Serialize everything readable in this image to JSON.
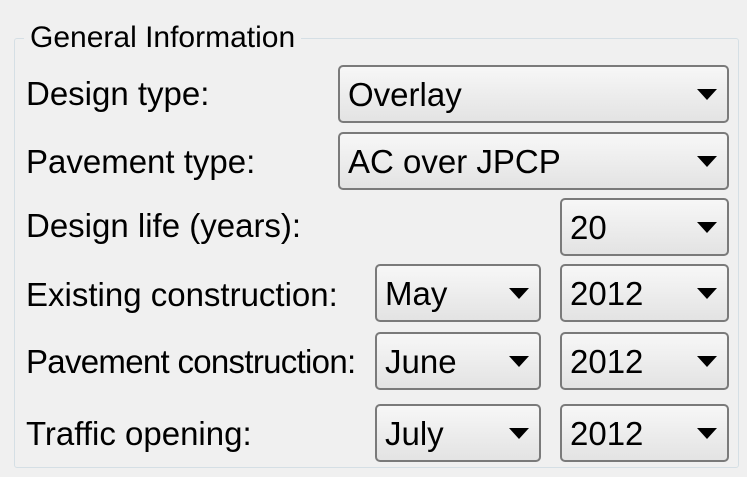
{
  "group": {
    "title": "General Information"
  },
  "rows": {
    "design_type": {
      "label": "Design type:",
      "value": "Overlay"
    },
    "pavement_type": {
      "label": "Pavement type:",
      "value": "AC over JPCP"
    },
    "design_life": {
      "label": "Design life (years):",
      "value": "20"
    },
    "existing_construction": {
      "label": "Existing construction:",
      "month": "May",
      "year": "2012"
    },
    "pavement_construction": {
      "label": "Pavement construction:",
      "month": "June",
      "year": "2012"
    },
    "traffic_opening": {
      "label": "Traffic opening:",
      "month": "July",
      "year": "2012"
    }
  },
  "icons": {
    "dropdown": "chevron-down-icon"
  }
}
